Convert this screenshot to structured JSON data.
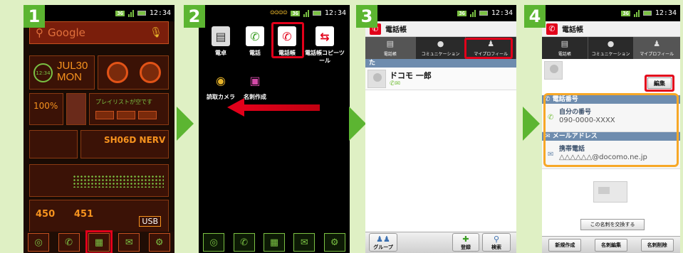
{
  "status": {
    "network": "3G",
    "time": "12:34"
  },
  "steps": [
    "1",
    "2",
    "3",
    "4"
  ],
  "home": {
    "search_placeholder": "Google",
    "clock_date": "JUL30",
    "clock_day": "MON",
    "clock_dial": "12:34",
    "battery": "100%",
    "playlist": "プレイリストが空です",
    "device_name": "SH06D NERV",
    "stat_a": "450",
    "stat_b": "451",
    "usb": "USB",
    "dock_icons": [
      "globe-icon",
      "phone-icon",
      "phonebook-icon",
      "mail-icon",
      "settings-icon"
    ]
  },
  "drawer": {
    "apps": [
      {
        "label": "電卓",
        "icon": "calculator-icon"
      },
      {
        "label": "電話",
        "icon": "phone-icon"
      },
      {
        "label": "電話帳",
        "icon": "phonebook-icon"
      },
      {
        "label": "電話帳コピーツール",
        "icon": "copy-tool-icon"
      },
      {
        "label": "読取カメラ",
        "icon": "camera-icon"
      },
      {
        "label": "名刺作成",
        "icon": "card-icon"
      }
    ]
  },
  "phonebook": {
    "title": "電話帳",
    "tabs": [
      "電話帳",
      "コミュニケーション",
      "マイプロフィール"
    ],
    "index_label": "た",
    "contact_name": "ドコモ 一郎",
    "bottom_group": "グループ",
    "bottom_register": "登録",
    "bottom_search": "検索"
  },
  "profile": {
    "edit": "編集",
    "phone_section": "電話番号",
    "phone_label": "自分の番号",
    "phone_value": "090-0000-XXXX",
    "mail_section": "メールアドレス",
    "mail_label": "携帯電話",
    "mail_value": "△△△△△△@docomo.ne.jp",
    "exchange_button": "この名刺を交換する",
    "bottom_new": "新規作成",
    "bottom_edit": "名刺編集",
    "bottom_delete": "名刺削除"
  }
}
